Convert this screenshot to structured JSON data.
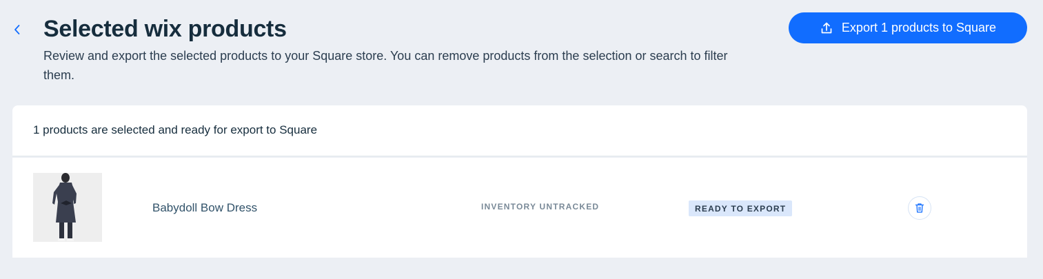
{
  "header": {
    "back_icon": "chevron-left-icon",
    "title": "Selected wix products",
    "subtitle": "Review and export the selected products to your Square store. You can remove products from the selection or search to filter them.",
    "export_button": {
      "icon": "upload-icon",
      "label": "Export 1 products to Square"
    }
  },
  "selection": {
    "summary": "1 products are selected and ready for export to Square"
  },
  "products": [
    {
      "image_alt": "Babydoll Bow Dress product photo",
      "name": "Babydoll Bow Dress",
      "inventory": "INVENTORY UNTRACKED",
      "status": "READY TO EXPORT",
      "delete_icon": "trash-icon"
    }
  ],
  "colors": {
    "accent": "#116dff",
    "page_background": "#eceff4",
    "card_background": "#ffffff",
    "badge_background": "#dae7fb"
  }
}
